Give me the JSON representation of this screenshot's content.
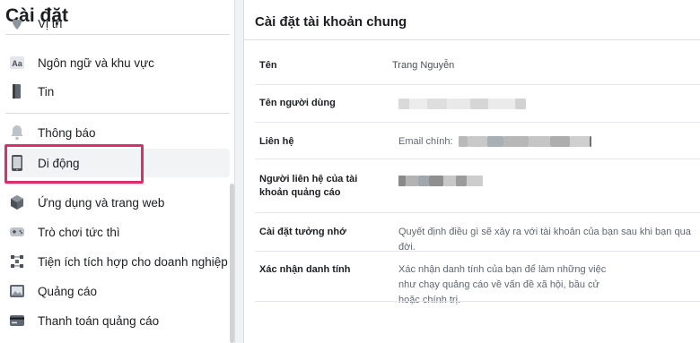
{
  "sidebar": {
    "title": "Cài đặt",
    "top_item": {
      "label": "Vị trí",
      "icon": "location-pin-icon"
    },
    "items": [
      {
        "label": "Ngôn ngữ và khu vực",
        "icon": "language-aa-icon"
      },
      {
        "label": "Tin",
        "icon": "stories-book-icon"
      },
      {
        "label": "Thông báo",
        "icon": "bell-icon"
      },
      {
        "label": "Di động",
        "icon": "mobile-phone-icon"
      },
      {
        "label": "Ứng dụng và trang web",
        "icon": "cube-apps-icon"
      },
      {
        "label": "Trò chơi tức thì",
        "icon": "game-controller-icon"
      },
      {
        "label": "Tiện ích tích hợp cho doanh nghiệp",
        "icon": "business-integrations-icon"
      },
      {
        "label": "Quảng cáo",
        "icon": "ads-image-icon"
      },
      {
        "label": "Thanh toán quảng cáo",
        "icon": "credit-card-icon"
      }
    ],
    "active_label": "Di động",
    "highlight_color": "#d8306b"
  },
  "main": {
    "title": "Cài đặt tài khoản chung",
    "rows": [
      {
        "label": "Tên",
        "value": "Trang Nguyễn"
      },
      {
        "label": "Tên người dùng",
        "value": ""
      },
      {
        "label": "Liên hệ",
        "value": "Email chính:"
      },
      {
        "label": "Người liên hệ của tài khoản quảng cáo",
        "value": ""
      },
      {
        "label": "Cài đặt tưởng nhớ",
        "value": "Quyết định điều gì sẽ xảy ra với tài khoản của bạn sau khi bạn qua đời."
      },
      {
        "label": "Xác nhận danh tính",
        "value": "Xác nhận danh tính của bạn để làm những việc như chạy quảng cáo về vấn đề xã hội, bầu cử hoặc chính trị."
      }
    ]
  }
}
